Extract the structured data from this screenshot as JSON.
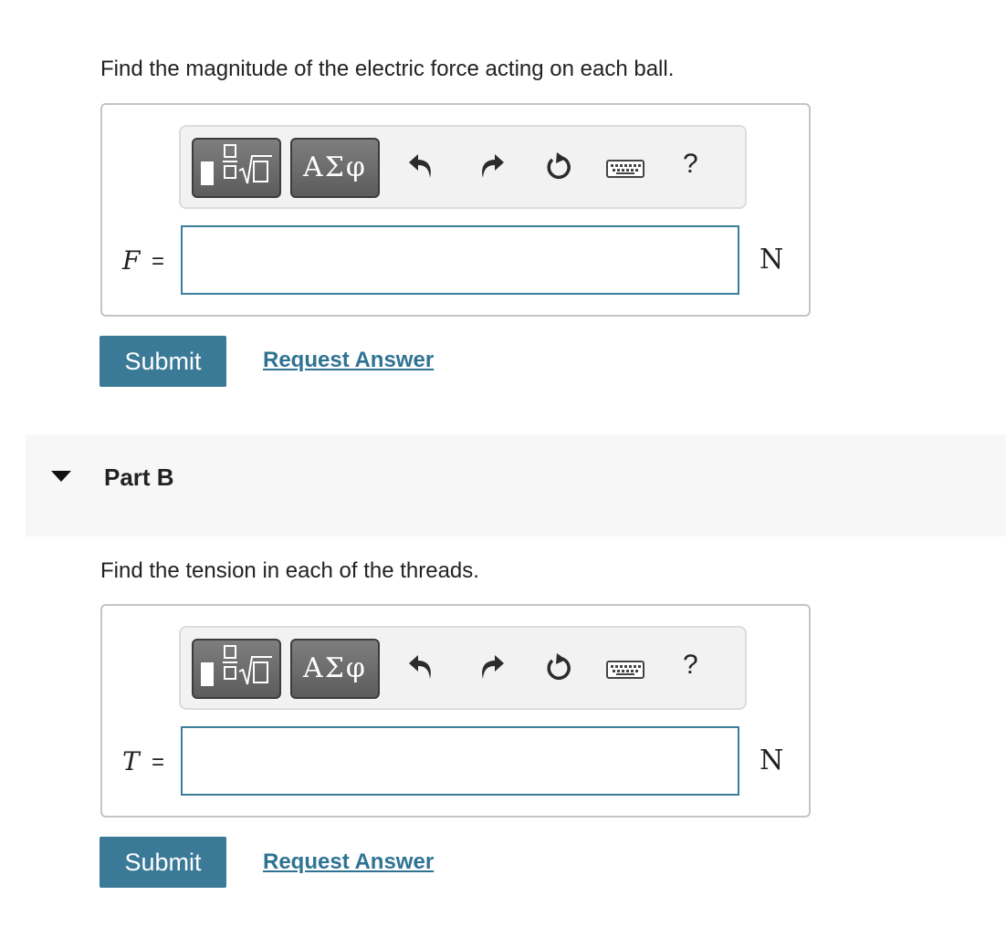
{
  "part_a": {
    "prompt": "Find the magnitude of the electric force acting on each ball.",
    "toolbar": {
      "templates_icon": "fraction-sqrt-templates-icon",
      "symbols_label": "ΑΣφ",
      "undo_icon": "undo-icon",
      "redo_icon": "redo-icon",
      "reset_icon": "reset-icon",
      "keyboard_icon": "keyboard-icon",
      "help_label": "?"
    },
    "variable": "F",
    "equals": "=",
    "input_value": "",
    "unit": "N",
    "submit_label": "Submit",
    "request_answer_label": "Request Answer"
  },
  "part_b": {
    "title": "Part B",
    "prompt": "Find the tension in each of the threads.",
    "toolbar": {
      "templates_icon": "fraction-sqrt-templates-icon",
      "symbols_label": "ΑΣφ",
      "undo_icon": "undo-icon",
      "redo_icon": "redo-icon",
      "reset_icon": "reset-icon",
      "keyboard_icon": "keyboard-icon",
      "help_label": "?"
    },
    "variable": "T",
    "equals": "=",
    "input_value": "",
    "unit": "N",
    "submit_label": "Submit",
    "request_answer_label": "Request Answer"
  }
}
